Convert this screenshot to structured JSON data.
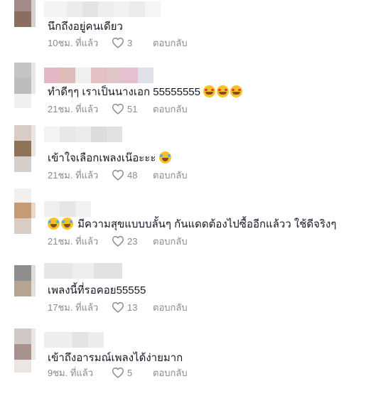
{
  "comments": [
    {
      "text": "นึกถึงอยู่คนเดียว",
      "time": "10ชม. ที่แล้ว",
      "likes": "3",
      "reply_label": "ตอบกลับ",
      "emojis": []
    },
    {
      "text": "ทำดีๆๆ เราเป็นนางเอก 55555555",
      "time": "21ชม. ที่แล้ว",
      "likes": "51",
      "reply_label": "ตอบกลับ",
      "emojis": [
        "smiling-face-with-hearts",
        "smiling-face-with-hearts",
        "smiling-face-with-hearts"
      ]
    },
    {
      "text": "เข้าใจเลือกเพลงเน๊อะะะ",
      "time": "21ชม. ที่แล้ว",
      "likes": "48",
      "reply_label": "ตอบกลับ",
      "emojis": [
        "rolling-laughing"
      ]
    },
    {
      "text": "มีความสุขแบบบลั้นๆ กันแดดต้องไปซื้ออีกแล้วว ใช้ดีจริงๆ",
      "time": "21ชม. ที่แล้ว",
      "likes": "23",
      "reply_label": "ตอบกลับ",
      "emojis": [
        "rolling-laughing",
        "rolling-laughing"
      ]
    },
    {
      "text": "เพลงนี้ที่รอคอย55555",
      "time": "17ชม. ที่แล้ว",
      "likes": "13",
      "reply_label": "ตอบกลับ",
      "emojis": []
    },
    {
      "text": "เข้าถึงอารมณ์เพลงได้ง่ายมาก",
      "time": "9ชม. ที่แล้ว",
      "likes": "5",
      "reply_label": "ตอบกลับ",
      "emojis": []
    }
  ]
}
